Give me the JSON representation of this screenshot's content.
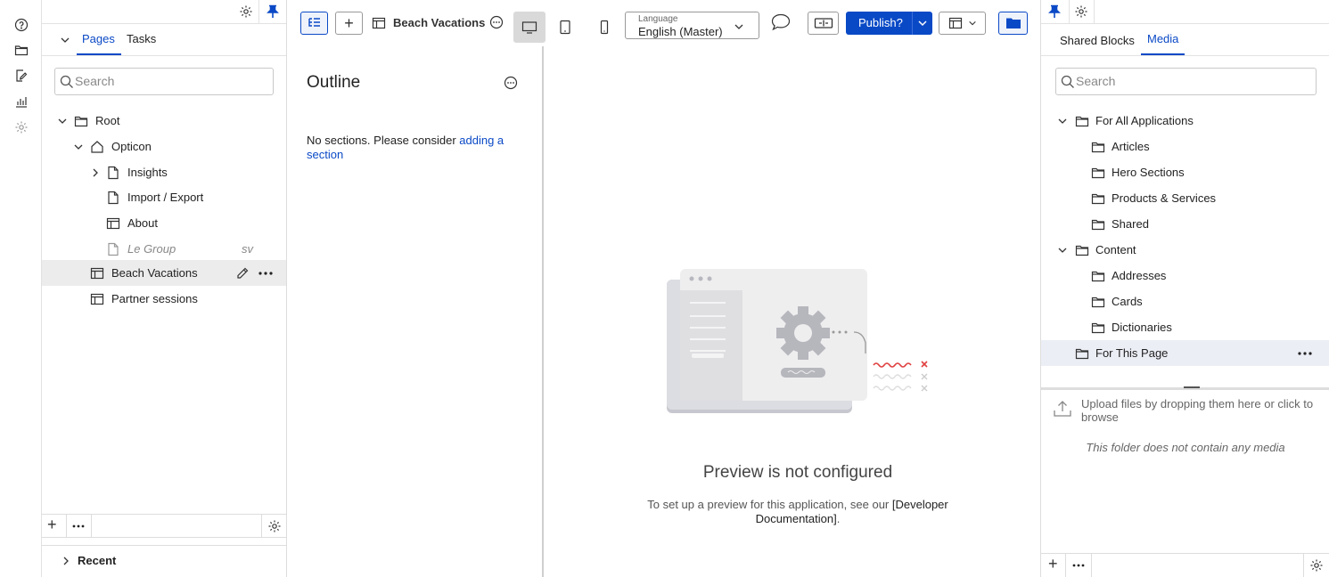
{
  "rail": {
    "items": [
      "help-icon",
      "folder-icon",
      "edit-page-icon",
      "analytics-icon",
      "settings-icon"
    ]
  },
  "left_panel": {
    "tabs": [
      "Pages",
      "Tasks"
    ],
    "search_placeholder": "Search",
    "tree": [
      {
        "label": "Root",
        "icon": "folder-icon",
        "expanded": true
      },
      {
        "label": "Opticon",
        "icon": "home-icon",
        "expanded": true
      },
      {
        "label": "Insights",
        "icon": "page-icon",
        "expanded": false
      },
      {
        "label": "Import / Export",
        "icon": "page-icon"
      },
      {
        "label": "About",
        "icon": "layout-icon"
      },
      {
        "label": "Le Group",
        "icon": "page-icon",
        "badge": "sv",
        "italic": true
      },
      {
        "label": "Beach Vacations",
        "icon": "layout-icon",
        "selected": true
      },
      {
        "label": "Partner sessions",
        "icon": "layout-icon"
      }
    ],
    "recent_label": "Recent"
  },
  "toolbar": {
    "page_title": "Beach Vacations",
    "language_label": "Language",
    "language_value": "English (Master)",
    "publish_label": "Publish?"
  },
  "outline": {
    "title": "Outline",
    "message": "No sections. Please consider ",
    "link": "adding a section"
  },
  "preview": {
    "title": "Preview is not configured",
    "desc_prefix": "To set up a preview for this application, see our ",
    "desc_link": "[Developer Documentation]",
    "desc_suffix": "."
  },
  "right_panel": {
    "tabs": [
      "Shared Blocks",
      "Media"
    ],
    "search_placeholder": "Search",
    "tree": [
      {
        "label": "For All Applications",
        "expanded": true
      },
      {
        "label": "Articles"
      },
      {
        "label": "Hero Sections"
      },
      {
        "label": "Products & Services"
      },
      {
        "label": "Shared"
      },
      {
        "label": "Content",
        "expanded": true
      },
      {
        "label": "Addresses"
      },
      {
        "label": "Cards"
      },
      {
        "label": "Dictionaries"
      },
      {
        "label": "For This Page",
        "selected": true
      }
    ],
    "upload_text": "Upload files by dropping them here or click to browse",
    "empty_text": "This folder does not contain any media"
  },
  "colors": {
    "accent": "#0a49c6",
    "selected_row": "#ececec",
    "selected_row_right": "#eceef6"
  }
}
